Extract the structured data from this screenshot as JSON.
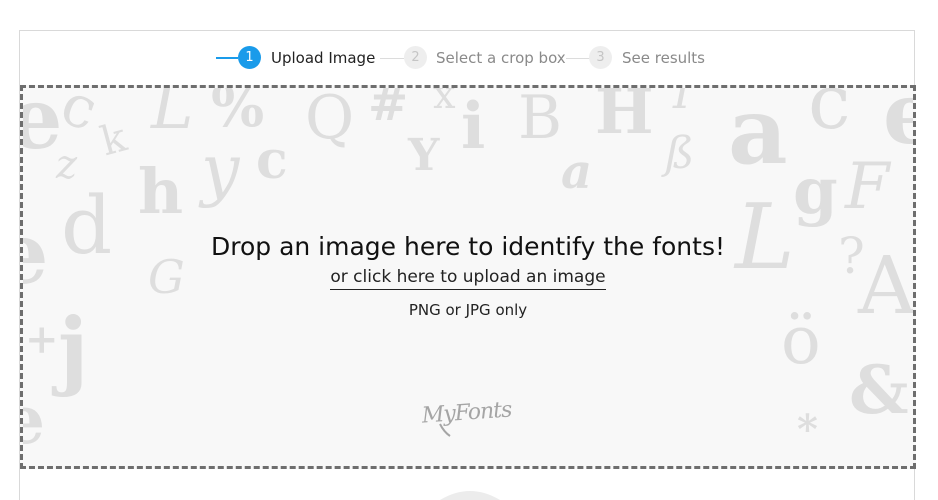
{
  "steps": [
    {
      "number": "1",
      "label": "Upload Image",
      "state": "active"
    },
    {
      "number": "2",
      "label": "Select a crop box",
      "state": "inactive"
    },
    {
      "number": "3",
      "label": "See results",
      "state": "inactive"
    }
  ],
  "dropzone": {
    "headline": "Drop an image here to identify the fonts!",
    "upload_link": "or click here to upload an image",
    "note": "PNG or JPG only"
  },
  "logo": {
    "text": "MyFonts"
  },
  "background_glyphs": [
    "e",
    "c",
    "k",
    "L",
    "%",
    "Q",
    "#",
    "x",
    "i",
    "B",
    "H",
    "I",
    "a",
    "c",
    "z",
    "d",
    "h",
    "y",
    "c",
    "Y",
    "a",
    "ß",
    "g",
    "F",
    "e",
    "G",
    "L",
    "?",
    "A",
    "j",
    "+",
    "ö",
    "&",
    "*"
  ],
  "colors": {
    "accent": "#1a9bea",
    "glyph": "#dedede",
    "border": "#6e6e6e"
  }
}
